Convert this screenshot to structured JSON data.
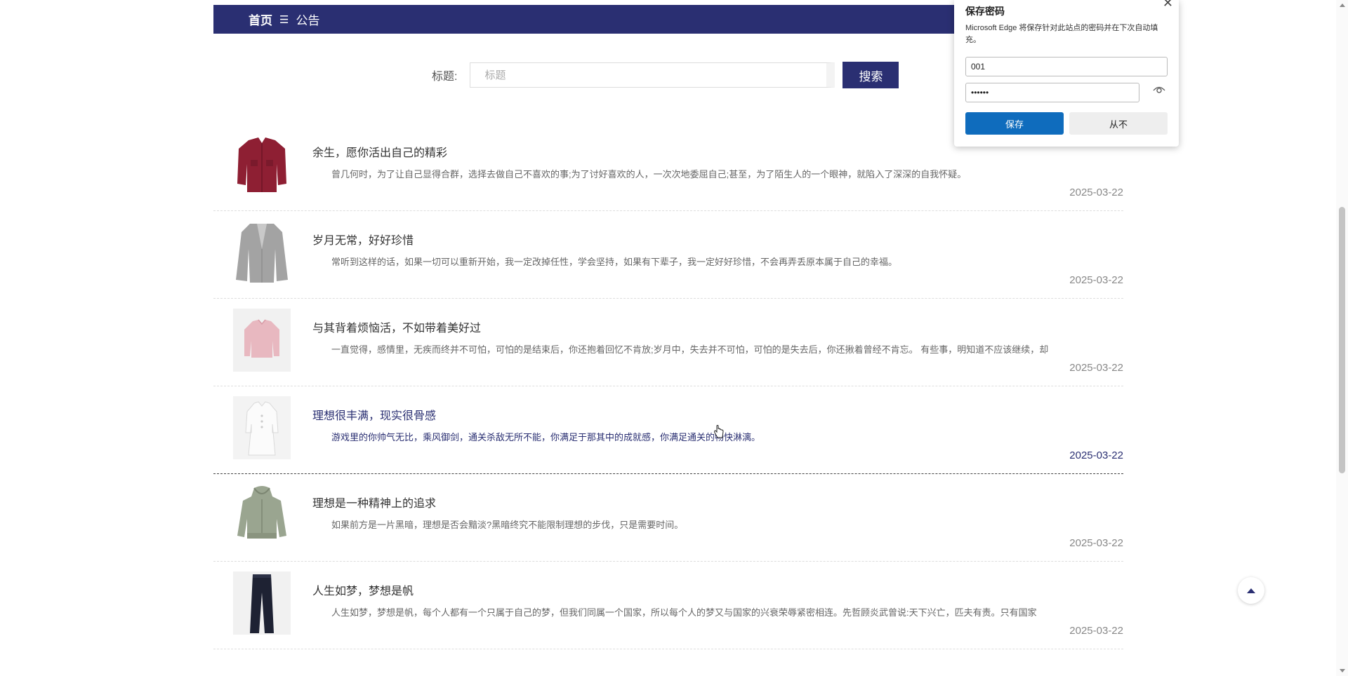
{
  "breadcrumb": {
    "home": "首页",
    "separator": "☰",
    "current": "公告"
  },
  "search": {
    "label": "标题:",
    "placeholder": "标题",
    "button": "搜索"
  },
  "notices": [
    {
      "title": "余生，愿你活出自己的精彩",
      "summary": "曾几何时，为了让自己显得合群，选择去做自己不喜欢的事;为了讨好喜欢的人，一次次地委屈自己;甚至，为了陌生人的一个眼神，就陷入了深深的自我怀疑。",
      "date": "2025-03-22",
      "image": "red-jacket"
    },
    {
      "title": "岁月无常，好好珍惜",
      "summary": "常听到这样的话，如果一切可以重新开始，我一定改掉任性，学会坚持，如果有下辈子，我一定好好珍惜，不会再弄丢原本属于自己的幸福。",
      "date": "2025-03-22",
      "image": "grey-coat"
    },
    {
      "title": "与其背着烦恼活，不如带着美好过",
      "summary": "一直觉得，感情里，无疾而终并不可怕，可怕的是结束后，你还抱着回忆不肯放;岁月中，失去并不可怕，可怕的是失去后，你还揪着曾经不肯忘。 有些事，明知道不应该继续，却",
      "date": "2025-03-22",
      "image": "pink-sweater"
    },
    {
      "title": "理想很丰满，现实很骨感",
      "summary": "游戏里的你帅气无比，乘风御剑，通关杀敌无所不能，你满足于那其中的成就感，你满足通关的畅快淋漓。",
      "date": "2025-03-22",
      "image": "white-dress"
    },
    {
      "title": "理想是一种精神上的追求",
      "summary": "如果前方是一片黑暗，理想是否会黯淡?黑暗终究不能限制理想的步伐，只是需要时间。",
      "date": "2025-03-22",
      "image": "green-hoodie"
    },
    {
      "title": "人生如梦，梦想是帆",
      "summary": "人生如梦，梦想是帆，每个人都有一个只属于自己的梦，但我们同属一个国家，所以每个人的梦又与国家的兴衰荣辱紧密相连。先哲顾炎武曾说:天下兴亡，匹夫有责。只有国家",
      "date": "2025-03-22",
      "image": "dark-jeans"
    }
  ],
  "password_popup": {
    "title": "保存密码",
    "description": "Microsoft Edge 将保存针对此站点的密码并在下次自动填充。",
    "username": "001",
    "password": "••••••",
    "save": "保存",
    "never": "从不"
  }
}
